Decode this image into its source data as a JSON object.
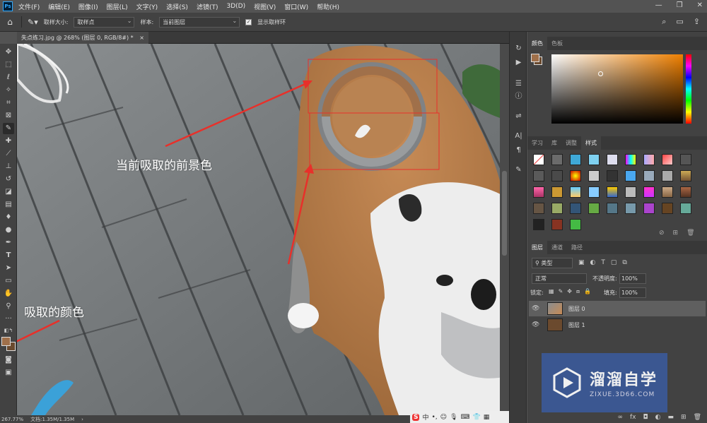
{
  "menubar": {
    "logo": "Ps",
    "items": [
      "文件(F)",
      "编辑(E)",
      "图像(I)",
      "图层(L)",
      "文字(Y)",
      "选择(S)",
      "滤镜(T)",
      "3D(D)",
      "视图(V)",
      "窗口(W)",
      "帮助(H)"
    ],
    "win_min": "—",
    "win_max": "❐",
    "win_close": "✕"
  },
  "options": {
    "sample_size_label": "取样大小:",
    "sample_size_value": "取样点",
    "sample_label": "样本:",
    "sample_value": "当前图层",
    "show_ring_label": "显示取样环",
    "show_ring_checked": true
  },
  "document": {
    "tab_title": "失点练习.jpg @ 268% (图层 0, RGB/8#) *",
    "close": "×"
  },
  "status": {
    "zoom": "267.77%",
    "doc_size": "文档:1.35M/1.35M"
  },
  "annotations": {
    "foreground": "当前吸取的前景色",
    "sampled": "吸取的颜色"
  },
  "colors": {
    "foreground": "#a0704a",
    "background": "#6b4a2e",
    "annotation_red": "#e8302a",
    "picker_hue": "#f08000"
  },
  "color_panel": {
    "tabs": [
      "颜色",
      "色板"
    ]
  },
  "styles_panel": {
    "tabs": [
      "学习",
      "库",
      "调整",
      "样式"
    ],
    "active_tab": "样式"
  },
  "layers_panel": {
    "tabs": [
      "图层",
      "通道",
      "路径"
    ],
    "filter_label": "类型",
    "blend_mode": "正常",
    "opacity_label": "不透明度:",
    "opacity_value": "100%",
    "lock_label": "锁定:",
    "fill_label": "填充:",
    "fill_value": "100%",
    "layers": [
      {
        "name": "图层 0",
        "selected": true
      },
      {
        "name": "图层 1",
        "selected": false
      }
    ]
  },
  "watermark": {
    "brand": "溜溜自学",
    "url": "ZIXUE.3D66.COM"
  },
  "ime": {
    "label": "中"
  }
}
